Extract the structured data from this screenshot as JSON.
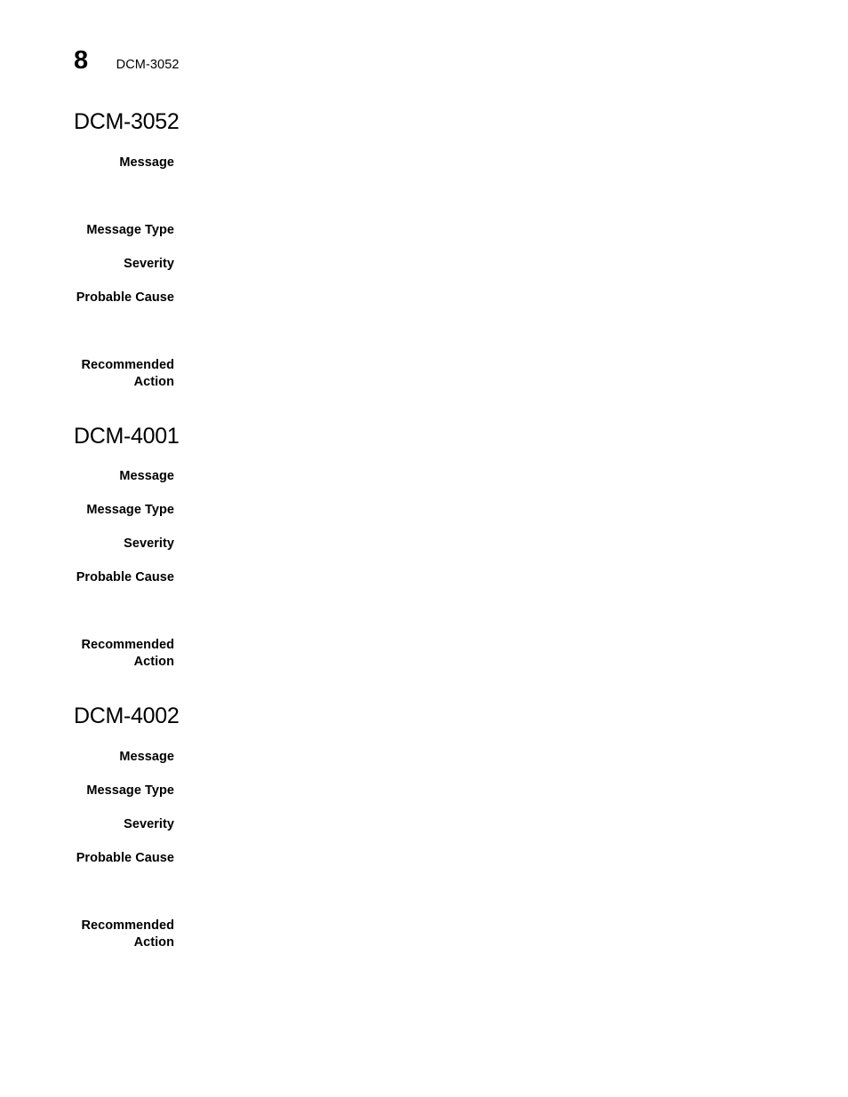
{
  "header": {
    "page_number": "8",
    "title": "DCM-3052"
  },
  "field_labels": {
    "message": "Message",
    "message_type": "Message Type",
    "severity": "Severity",
    "probable_cause": "Probable Cause",
    "recommended_action": "Recommended\nAction"
  },
  "sections": [
    {
      "heading": "DCM-3052",
      "fields": [
        {
          "label": "Message",
          "value": "",
          "value_lines": 2
        },
        {
          "label": "Message Type",
          "value": "",
          "value_lines": 1
        },
        {
          "label": "Severity",
          "value": "",
          "value_lines": 1
        },
        {
          "label": "Probable Cause",
          "value": "",
          "value_lines": 2
        },
        {
          "label": "Recommended\nAction",
          "value": "",
          "value_lines": 2
        }
      ]
    },
    {
      "heading": "DCM-4001",
      "fields": [
        {
          "label": "Message",
          "value": "",
          "value_lines": 1
        },
        {
          "label": "Message Type",
          "value": "",
          "value_lines": 1
        },
        {
          "label": "Severity",
          "value": "",
          "value_lines": 1
        },
        {
          "label": "Probable Cause",
          "value": "",
          "value_lines": 2
        },
        {
          "label": "Recommended\nAction",
          "value": "",
          "value_lines": 2
        }
      ]
    },
    {
      "heading": "DCM-4002",
      "fields": [
        {
          "label": "Message",
          "value": "",
          "value_lines": 1
        },
        {
          "label": "Message Type",
          "value": "",
          "value_lines": 1
        },
        {
          "label": "Severity",
          "value": "",
          "value_lines": 1
        },
        {
          "label": "Probable Cause",
          "value": "",
          "value_lines": 2
        },
        {
          "label": "Recommended\nAction",
          "value": "",
          "value_lines": 2
        }
      ]
    }
  ],
  "colors": {
    "page_background": "#ffffff",
    "text": "#000000"
  }
}
